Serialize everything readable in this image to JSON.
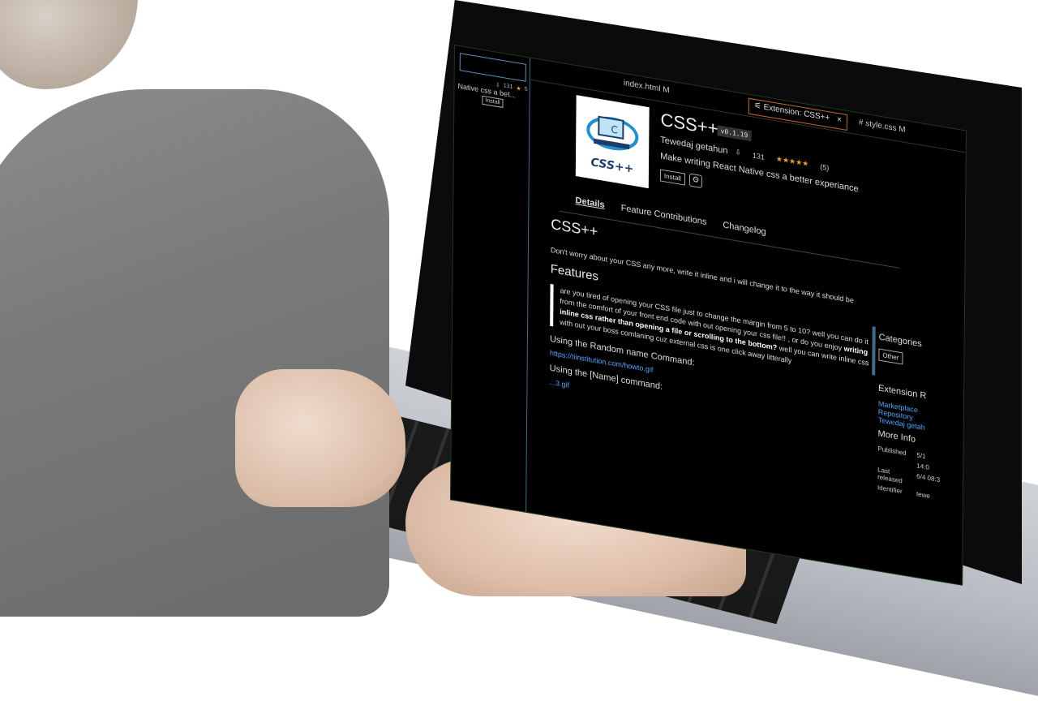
{
  "sidebar": {
    "item": {
      "downloads": "131",
      "rating": "5",
      "description": "Native css a bet...",
      "install_label": "Install"
    }
  },
  "tabs": [
    {
      "label": "index.html M"
    },
    {
      "label": "Extension: CSS++",
      "close": "×"
    },
    {
      "label": "style.css M"
    }
  ],
  "extension": {
    "logo_text": "CSS++",
    "name": "CSS++",
    "version": "v0.1.19",
    "author": "Tewedaj getahun",
    "downloads": "131",
    "rating_stars": "★★★★★",
    "rating_count": "(5)",
    "description": "Make writing React Native css a better experiance",
    "install_label": "Install",
    "gear_icon": "⚙"
  },
  "nav": {
    "details": "Details",
    "contributions": "Feature Contributions",
    "changelog": "Changelog"
  },
  "readme": {
    "title": "CSS++",
    "lead": "Don't worry about your CSS any more, write it inline and i will change it to the way it should be",
    "features_heading": "Features",
    "quote_1": "are you tired of opening your CSS file just to change the margin from 5 to 10? well you can do it from the comfort of your front end code with out opening your css file!! , or do you enjoy ",
    "quote_bold": "writing inline css rather than opening a file or scrolling to the bottom?",
    "quote_2": " well you can write inline css with out your boss comlaning cuz external css is one click away litterally",
    "random_command": "Using the Random name Command:",
    "random_link": "https://tiinstitution.com/howto.gif",
    "name_command": "Using the [Name] command:",
    "name_link": "...3.gif"
  },
  "right_panel": {
    "categories_heading": "Categories",
    "category": "Other",
    "resources_heading": "Extension R",
    "links": [
      "Marketplace",
      "Repository",
      "Tewedaj getah"
    ],
    "more_info_heading": "More Info",
    "info": [
      {
        "label": "Published",
        "value": "5/1"
      },
      {
        "label": "",
        "value": "14:0"
      },
      {
        "label": "Last released",
        "value": "6/4 08:3"
      },
      {
        "label": "Identifier",
        "value": "tewe"
      }
    ]
  }
}
